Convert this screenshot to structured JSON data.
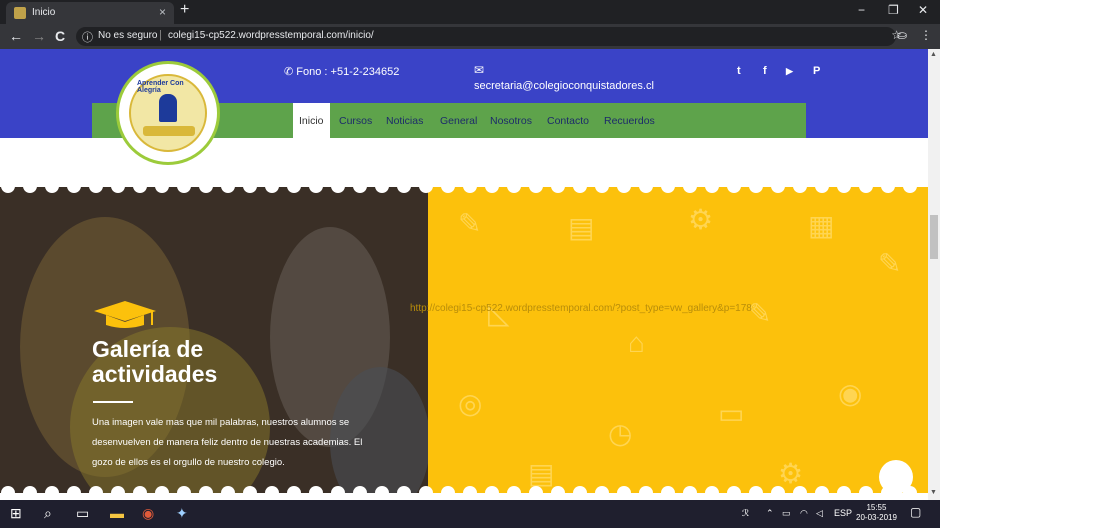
{
  "browser": {
    "tab_title": "Inicio",
    "tab_close": "×",
    "new_tab": "+",
    "win_min": "−",
    "win_max": "❐",
    "win_close": "✕",
    "back": "←",
    "forward": "→",
    "reload": "C",
    "security_icon": "ⓘ",
    "security_text": "No es seguro",
    "url_sep": "|",
    "url": "colegi15-cp522.wordpresstemporal.com/inicio/",
    "star": "☆",
    "menu_dots": "⋮"
  },
  "header": {
    "phone": "Fono : +51-2-234652",
    "phone_icon": "✆",
    "mail_icon": "✉",
    "email": "secretaria@colegioconquistadores.cl",
    "social": [
      {
        "icon": "twitter-icon",
        "glyph": "t"
      },
      {
        "icon": "facebook-icon",
        "glyph": "f"
      },
      {
        "icon": "youtube-icon",
        "glyph": "▶"
      },
      {
        "icon": "pinterest-icon",
        "glyph": "P"
      }
    ],
    "logo_text": "Aprender Con Alegría"
  },
  "nav": {
    "items": [
      "Inicio",
      "Cursos",
      "Noticias",
      "General",
      "Nosotros",
      "Contacto",
      "Recuerdos"
    ],
    "active_index": 0
  },
  "gallery": {
    "title_line1": "Galería de",
    "title_line2": "actividades",
    "description": "Una imagen vale mas que mil palabras, nuestros alumnos se desenvuelven de manera feliz dentro de nuestras academias. El gozo de ellos es el orgullo de nuestro colegio.",
    "link": "http://colegi15-cp522.wordpresstemporal.com/?post_type=vw_gallery&p=178"
  },
  "taskbar": {
    "tray_lang": "ESP",
    "time": "15:55",
    "date": "20-03-2019"
  },
  "colors": {
    "header_blue": "#3a43c7",
    "nav_green": "#5ea34b",
    "gallery_yellow": "#fcc10c"
  }
}
